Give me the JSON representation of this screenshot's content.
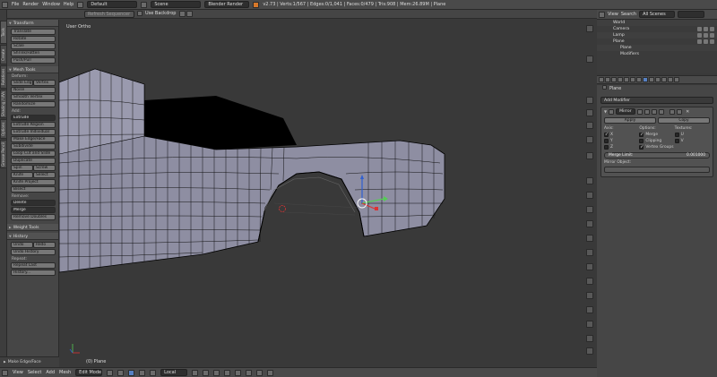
{
  "topbar": {
    "menus": [
      "File",
      "Render",
      "Window",
      "Help"
    ],
    "layout": "Default",
    "scene": "Scene",
    "engine": "Blender Render",
    "stats": "v2.73 | Verts:1/567 | Edges:0/1,041 | Faces:0/479 | Tris:908 | Mem:26.89M | Plane"
  },
  "header2": {
    "seq": "Refresh Sequencer",
    "backdrop": "Use Backdrop"
  },
  "shelf_tabs": [
    "Tools",
    "Create",
    "Relations",
    "Shading / UVs",
    "Options",
    "Grease Pencil"
  ],
  "tool_shelf": {
    "transform": {
      "title": "Transform",
      "buttons": [
        "Translate",
        "Rotate",
        "Scale",
        "Shrink/Fatten",
        "Push/Pull"
      ]
    },
    "mesh_tools": {
      "title": "Mesh Tools",
      "deform_label": "Deform:",
      "slide": [
        "Slide Edg",
        "Vertex"
      ],
      "deform_buttons": [
        "Noise",
        "Smooth Vertex",
        "Randomize"
      ],
      "add_label": "Add:",
      "extrude": "Extrude",
      "add_buttons": [
        "Extrude Region",
        "Extrude Individual",
        "Make Edge/Face",
        "Subdivide",
        "Loop Cut and Slide",
        "Duplicate"
      ],
      "spin_screw": [
        "Spin",
        "Screw"
      ],
      "knife_select": [
        "Knife",
        "Select"
      ],
      "knife_bisect": [
        "Knife Project",
        "Bisect"
      ],
      "remove_label": "Remove:",
      "delete": "Delete",
      "merge": "Merge",
      "remove_doubles": "Remove Doubles"
    },
    "weight_tools": {
      "title": "Weight Tools"
    },
    "history": {
      "title": "History",
      "undo_redo": [
        "Undo",
        "Redo"
      ],
      "buttons": [
        "Undo History"
      ],
      "repeat_label": "Repeat:",
      "repeat_buttons": [
        "Repeat Last",
        "History..."
      ]
    }
  },
  "operator_panel": "Make Edge/Face",
  "viewport": {
    "label": "User Ortho",
    "object_label": "(0) Plane"
  },
  "bottombar": {
    "menus": [
      "View",
      "Select",
      "Add",
      "Mesh"
    ],
    "mode": "Edit Mode",
    "orientation": "Local"
  },
  "outliner": {
    "tabs": [
      "View",
      "Search"
    ],
    "filter": "All Scenes",
    "rows": [
      "World",
      "Camera",
      "Lamp",
      "Plane",
      "Plane",
      "Modifiers"
    ]
  },
  "properties": {
    "breadcrumb": "Plane",
    "add_modifier": "Add Modifier",
    "modifier": {
      "name": "Mirror",
      "apply": "Apply",
      "copy": "Copy",
      "axis_title": "Axis:",
      "options_title": "Options:",
      "textures_title": "Textures:",
      "axes": [
        "X",
        "Y",
        "Z"
      ],
      "options": [
        "Merge",
        "Clipping",
        "Vertex Groups"
      ],
      "textures": [
        "U",
        "V"
      ],
      "merge_limit_label": "Merge Limit:",
      "merge_limit_value": "0.001000",
      "mirror_object_label": "Mirror Object:"
    }
  },
  "colors": {
    "header": "#4a4a4a",
    "panel": "#464646",
    "viewport": "#393939",
    "mesh_face": "#8e8ea2",
    "wire": "#000000",
    "active_tab": "#5680c2"
  }
}
